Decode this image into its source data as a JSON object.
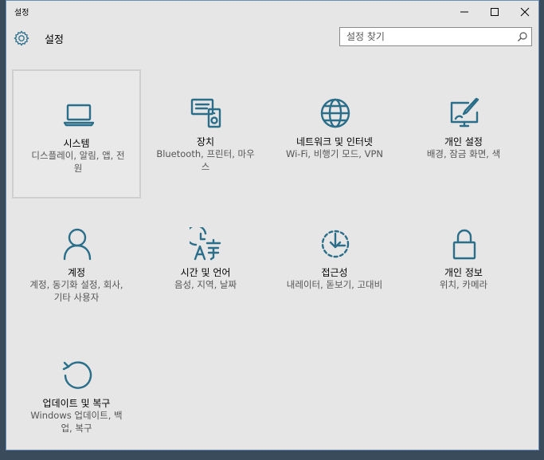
{
  "window": {
    "title": "설정"
  },
  "header": {
    "title": "설정",
    "search_placeholder": "설정 찾기"
  },
  "colors": {
    "accent": "#2a6e8a",
    "background": "#e6e6e6"
  },
  "tiles": [
    {
      "title": "시스템",
      "desc": "디스플레이, 알림, 앱, 전원",
      "icon": "laptop-icon"
    },
    {
      "title": "장치",
      "desc": "Bluetooth, 프린터, 마우스",
      "icon": "devices-icon"
    },
    {
      "title": "네트워크 및 인터넷",
      "desc": "Wi-Fi, 비행기 모드, VPN",
      "icon": "globe-icon"
    },
    {
      "title": "개인 설정",
      "desc": "배경, 잠금 화면, 색",
      "icon": "paint-icon"
    },
    {
      "title": "계정",
      "desc": "계정, 동기화 설정, 회사, 기타 사용자",
      "icon": "person-icon"
    },
    {
      "title": "시간 및 언어",
      "desc": "음성, 지역, 날짜",
      "icon": "time-language-icon"
    },
    {
      "title": "접근성",
      "desc": "내레이터, 돋보기, 고대비",
      "icon": "ease-of-access-icon"
    },
    {
      "title": "개인 정보",
      "desc": "위치, 카메라",
      "icon": "lock-icon"
    },
    {
      "title": "업데이트 및 복구",
      "desc": "Windows 업데이트, 백업, 복구",
      "icon": "update-icon"
    }
  ]
}
